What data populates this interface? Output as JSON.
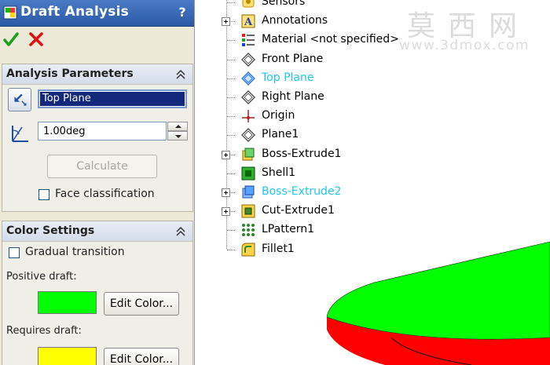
{
  "panel": {
    "title": "Draft Analysis",
    "help": "?",
    "analysis_group": {
      "title": "Analysis Parameters",
      "plane_field_value": "Top Plane",
      "angle_value": "1.00deg",
      "calculate_label": "Calculate",
      "face_classification_label": "Face classification"
    },
    "color_group": {
      "title": "Color Settings",
      "gradual_label": "Gradual transition",
      "positive_label": "Positive draft:",
      "positive_color": "#00ff00",
      "edit_color_label": "Edit Color...",
      "requires_label": "Requires draft:",
      "requires_color": "#ffff00"
    }
  },
  "tree": {
    "items": [
      {
        "label": "Sensors",
        "icon": "sensor-icon",
        "expandable": false,
        "selected": false
      },
      {
        "label": "Annotations",
        "icon": "annotations-icon",
        "expandable": true,
        "selected": false
      },
      {
        "label": "Material <not specified>",
        "icon": "material-icon",
        "expandable": false,
        "selected": false
      },
      {
        "label": "Front Plane",
        "icon": "plane-icon",
        "expandable": false,
        "selected": false
      },
      {
        "label": "Top Plane",
        "icon": "plane-selected-icon",
        "expandable": false,
        "selected": true
      },
      {
        "label": "Right Plane",
        "icon": "plane-icon",
        "expandable": false,
        "selected": false
      },
      {
        "label": "Origin",
        "icon": "origin-icon",
        "expandable": false,
        "selected": false
      },
      {
        "label": "Plane1",
        "icon": "plane-icon",
        "expandable": false,
        "selected": false
      },
      {
        "label": "Boss-Extrude1",
        "icon": "boss-extrude-icon",
        "expandable": true,
        "selected": false
      },
      {
        "label": "Shell1",
        "icon": "shell-icon",
        "expandable": false,
        "selected": false
      },
      {
        "label": "Boss-Extrude2",
        "icon": "boss-extrude-selected-icon",
        "expandable": true,
        "selected": true
      },
      {
        "label": "Cut-Extrude1",
        "icon": "cut-extrude-icon",
        "expandable": true,
        "selected": false
      },
      {
        "label": "LPattern1",
        "icon": "linear-pattern-icon",
        "expandable": false,
        "selected": false
      },
      {
        "label": "Fillet1",
        "icon": "fillet-icon",
        "expandable": false,
        "selected": false
      }
    ]
  },
  "watermark": {
    "cn": "莫西网",
    "url": "www.3dmox.com"
  },
  "colors": {
    "selected_text": "#21c6ef",
    "model_top": "#00ff00",
    "model_side": "#ff0000"
  }
}
